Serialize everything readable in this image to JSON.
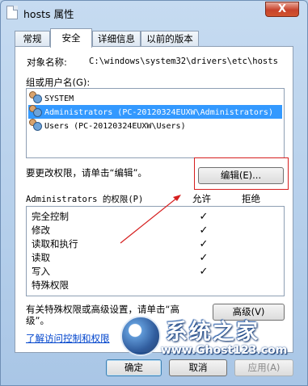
{
  "window": {
    "title": "hosts 属性",
    "close_glyph": "X"
  },
  "tabs": [
    {
      "label": "常规"
    },
    {
      "label": "安全"
    },
    {
      "label": "详细信息"
    },
    {
      "label": "以前的版本"
    }
  ],
  "security": {
    "object_label": "对象名称:",
    "object_value": "C:\\windows\\system32\\drivers\\etc\\hosts",
    "groups_label": "组或用户名(G):",
    "groups": [
      {
        "name": "SYSTEM",
        "icon": "users-icon",
        "selected": false
      },
      {
        "name": "Administrators (PC-20120324EUXW\\Administrators)",
        "icon": "users-icon",
        "selected": true
      },
      {
        "name": "Users (PC-20120324EUXW\\Users)",
        "icon": "users-icon",
        "selected": false
      }
    ],
    "change_hint": "要更改权限，请单击“编辑”。",
    "edit_button": "编辑(E)...",
    "permissions_label": "Administrators 的权限(P)",
    "allow_header": "允许",
    "deny_header": "拒绝",
    "permissions": [
      {
        "name": "完全控制",
        "allow": "✓",
        "deny": ""
      },
      {
        "name": "修改",
        "allow": "✓",
        "deny": ""
      },
      {
        "name": "读取和执行",
        "allow": "✓",
        "deny": ""
      },
      {
        "name": "读取",
        "allow": "✓",
        "deny": ""
      },
      {
        "name": "写入",
        "allow": "✓",
        "deny": ""
      },
      {
        "name": "特殊权限",
        "allow": "",
        "deny": ""
      }
    ],
    "advanced_hint_line1": "有关特殊权限或高级设置，请单击“高",
    "advanced_hint_line2": "级”。",
    "advanced_button": "高级(V)",
    "learn_link": "了解访问控制和权限"
  },
  "footer": {
    "ok": "确定",
    "cancel": "取消",
    "apply": "应用(A)"
  },
  "watermark": {
    "line1": "系统之家",
    "line2": "www.Ghost123.com"
  },
  "colors": {
    "selection": "#3399ff",
    "annotation_red": "#d61f1f",
    "link": "#0044cc"
  }
}
